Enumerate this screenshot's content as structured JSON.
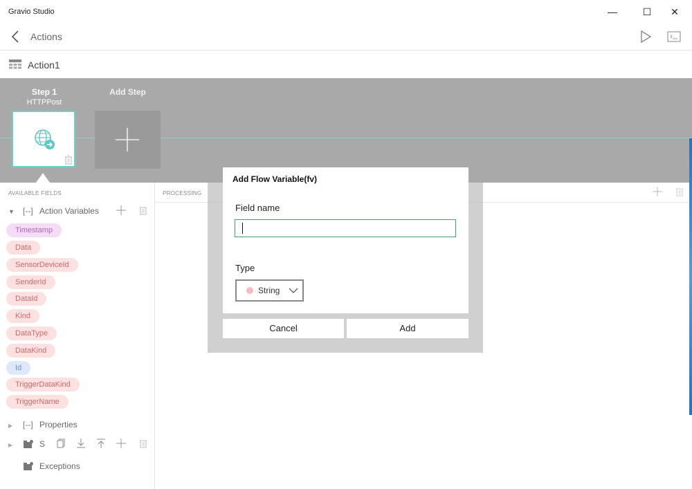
{
  "window": {
    "title": "Gravio Studio",
    "minimize_glyph": "—",
    "maximize_glyph": "☐",
    "close_glyph": "✕"
  },
  "nav": {
    "title": "Actions",
    "back_icon": "chevron-left-icon",
    "run_icon": "play-icon",
    "console_icon": "console-icon"
  },
  "action": {
    "name": "Action1",
    "icon": "action-list-icon"
  },
  "steps": [
    {
      "label": "Step 1",
      "component": "HTTPPost",
      "icon": "globe-arrow-icon"
    }
  ],
  "add_step": {
    "label": "Add Step"
  },
  "available_fields": {
    "header": "AVAILABLE FIELDS",
    "action_variables": {
      "label": "Action Variables",
      "items": [
        {
          "name": "Timestamp",
          "color": "purple"
        },
        {
          "name": "Data",
          "color": "pink"
        },
        {
          "name": "SensorDeviceId",
          "color": "pink"
        },
        {
          "name": "SenderId",
          "color": "pink"
        },
        {
          "name": "DataId",
          "color": "pink"
        },
        {
          "name": "Kind",
          "color": "pink"
        },
        {
          "name": "DataType",
          "color": "pink"
        },
        {
          "name": "DataKind",
          "color": "pink"
        },
        {
          "name": "Id",
          "color": "blue"
        },
        {
          "name": "TriggerDataKind",
          "color": "pink"
        },
        {
          "name": "TriggerName",
          "color": "pink"
        }
      ]
    },
    "properties": {
      "label": "Properties"
    },
    "s_section": {
      "label": "S"
    },
    "exceptions": {
      "label": "Exceptions"
    }
  },
  "processing": {
    "header": "PROCESSING"
  },
  "dialog": {
    "title": "Add Flow Variable(fv)",
    "field_name_label": "Field name",
    "field_name_value": "",
    "type_label": "Type",
    "type_value": "String",
    "type_color": "#f7b9c2",
    "cancel_label": "Cancel",
    "add_label": "Add"
  }
}
